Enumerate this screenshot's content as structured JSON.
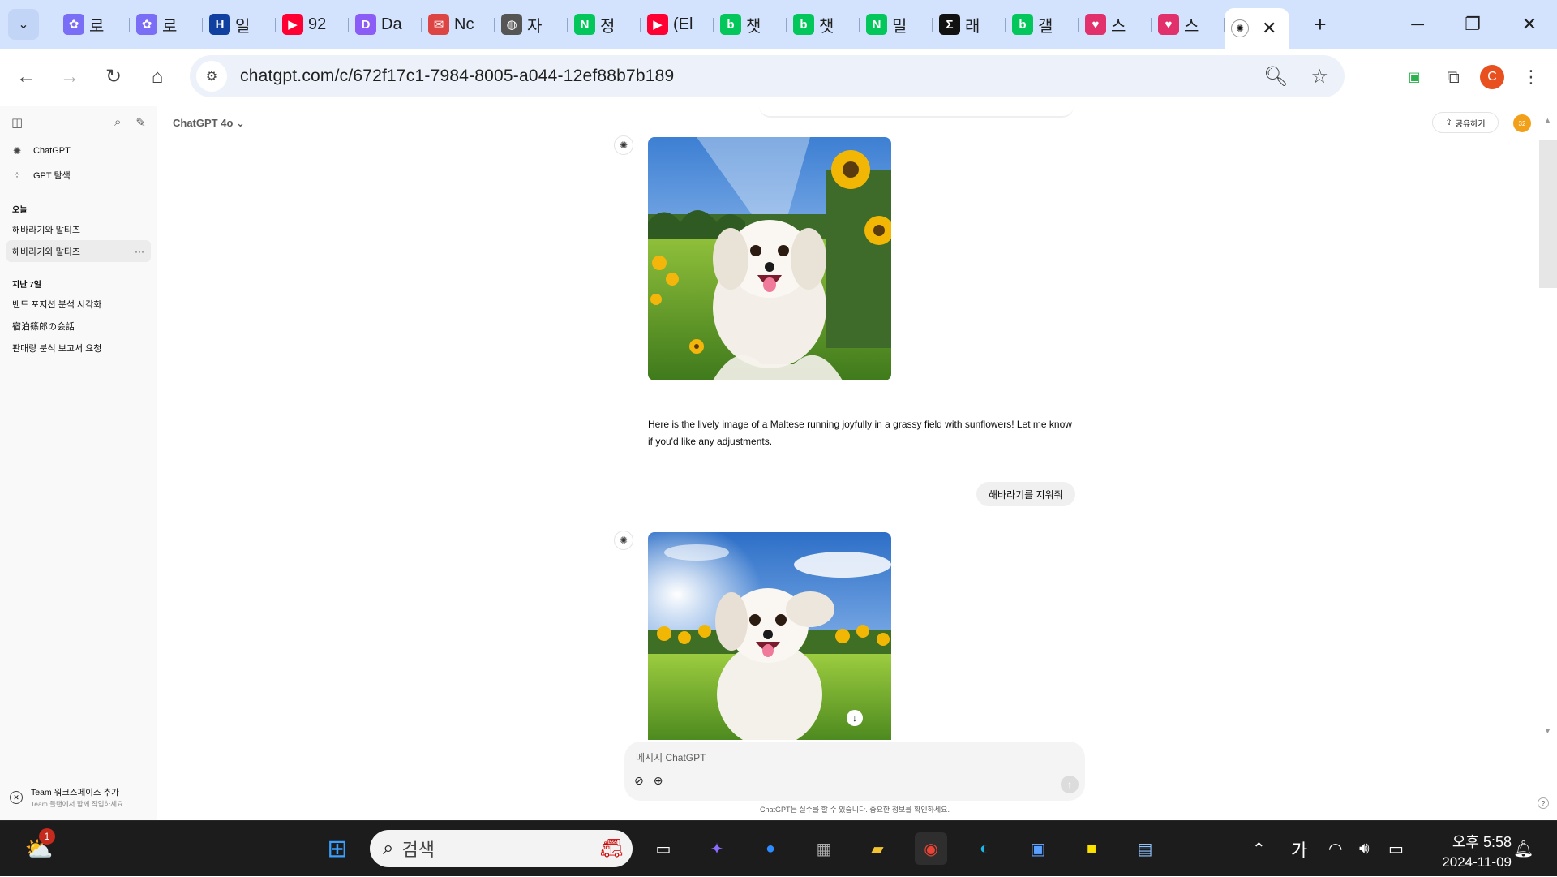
{
  "browser": {
    "tabs": [
      {
        "label": "로",
        "icon": "flower-icon",
        "color": "#7b6ef6"
      },
      {
        "label": "로",
        "icon": "flower-icon",
        "color": "#7b6ef6"
      },
      {
        "label": "일",
        "icon": "hankyung-icon",
        "color": "#1040a0"
      },
      {
        "label": "92",
        "icon": "youtube-icon",
        "color": "#ff0033"
      },
      {
        "label": "Da",
        "icon": "dalle-icon",
        "color": "#8b5cf6"
      },
      {
        "label": "Nc",
        "icon": "mail-icon",
        "color": "#d44"
      },
      {
        "label": "자",
        "icon": "globe-icon",
        "color": "#555"
      },
      {
        "label": "정",
        "icon": "naver-icon",
        "color": "#03c75a"
      },
      {
        "label": "(El",
        "icon": "youtube-icon",
        "color": "#ff0033"
      },
      {
        "label": "챗",
        "icon": "blog-icon",
        "color": "#03c75a"
      },
      {
        "label": "챗",
        "icon": "blog-icon",
        "color": "#03c75a"
      },
      {
        "label": "밀",
        "icon": "naver-icon",
        "color": "#03c75a"
      },
      {
        "label": "래",
        "icon": "sigma-icon",
        "color": "#111111"
      },
      {
        "label": "갤",
        "icon": "blog-icon",
        "color": "#03c75a"
      },
      {
        "label": "스",
        "icon": "heart-code-icon",
        "color": "#e1306c"
      },
      {
        "label": "스",
        "icon": "heart-code-icon",
        "color": "#e1306c"
      }
    ],
    "active_tab_close": "✕",
    "url": "chatgpt.com/c/672f17c1-7984-8005-a044-12ef88b7b189",
    "profile_initial": "C"
  },
  "sidebar": {
    "items": [
      {
        "label": "ChatGPT",
        "icon": "openai-icon"
      },
      {
        "label": "GPT 탐색",
        "icon": "grid-icon"
      }
    ],
    "groups": [
      {
        "title": "오늘",
        "chats": [
          "해바라기와 말티즈",
          "해바라기와 말티즈"
        ]
      },
      {
        "title": "지난 7일",
        "chats": [
          "밴드 포지션 분석 시각화",
          "宿泊篠郎の会話",
          "판매량 분석 보고서 요청"
        ]
      }
    ],
    "team_title": "Team 워크스페이스 추가",
    "team_subtitle": "Team 플랜에서 함께 작업하세요"
  },
  "header": {
    "model": "ChatGPT 4o",
    "share_label": "공유하기",
    "avatar_text": "32"
  },
  "conversation": {
    "assistant_text": "Here is the lively image of a Maltese running joyfully in a grassy field with sunflowers! Let me know if you'd like any adjustments.",
    "user_message": "해바라기를 지워줘"
  },
  "composer": {
    "placeholder": "메시지 ChatGPT",
    "disclaimer": "ChatGPT는 실수를 할 수 있습니다. 중요한 정보를 확인하세요."
  },
  "taskbar": {
    "search_label": "검색",
    "widget_badge": "1",
    "ime_label": "가",
    "time": "오후 5:58",
    "date": "2024-11-09"
  },
  "colors": {
    "tabbar": "#d3e3fd",
    "omnibox": "#edf2fa",
    "sidebar": "#f9f9f9",
    "taskbar": "#1c1c1c"
  }
}
